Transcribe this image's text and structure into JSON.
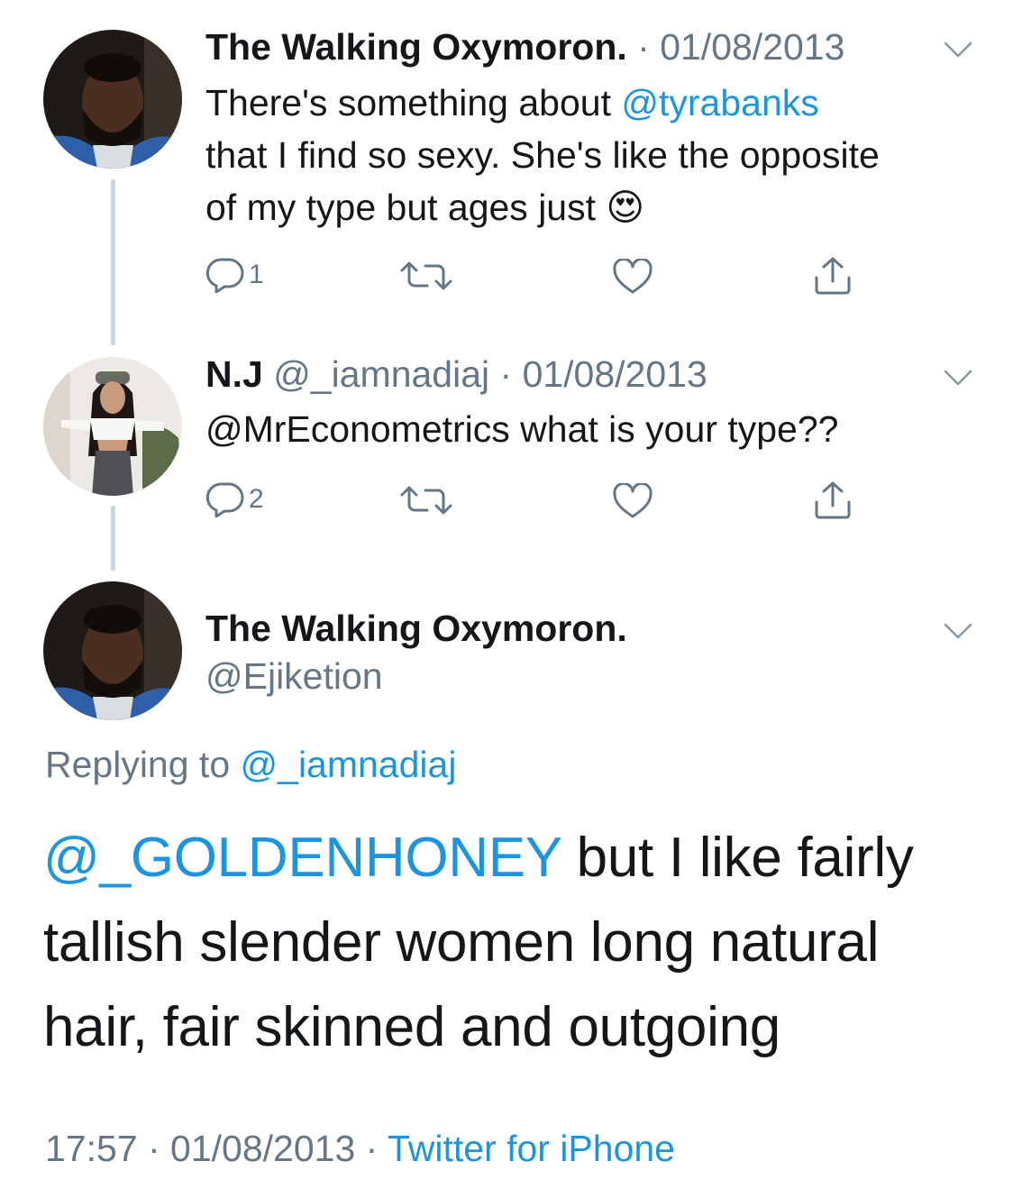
{
  "tweet1": {
    "name": "The Walking Oxymoron.",
    "sep": " · ",
    "date": "01/08/2013",
    "text_l1_pre": "There's something about ",
    "text_l1_mention": "@tyrabanks",
    "text_l2": "that I find so sexy. She's like the opposite",
    "text_l3": "of my type but ages just ",
    "emoji": "😍",
    "reply_count": "1"
  },
  "tweet2": {
    "name": "N.J",
    "handle": " @_iamnadiaj",
    "sep": " · ",
    "date": "01/08/2013",
    "text": "@MrEconometrics what is your type??",
    "reply_count": "2"
  },
  "main": {
    "name": "The Walking Oxymoron.",
    "handle": "@Ejiketion",
    "replying_label": "Replying to ",
    "replying_mention": "@_iamnadiaj",
    "text_mention": "@_GOLDENHONEY",
    "text_rest_l1": " but I like fairly",
    "text_l2": "tallish slender women long natural",
    "text_l3": "hair, fair skinned and outgoing",
    "time": "17:57",
    "sep1": " · ",
    "date": "01/08/2013",
    "sep2": " · ",
    "source": "Twitter for iPhone"
  },
  "icons": [
    "reply-icon",
    "retweet-icon",
    "like-icon",
    "share-icon",
    "chevron-down-icon"
  ],
  "colors": {
    "link": "#1b95e0",
    "muted": "#657786",
    "thread_line": "#ccd6dd"
  }
}
